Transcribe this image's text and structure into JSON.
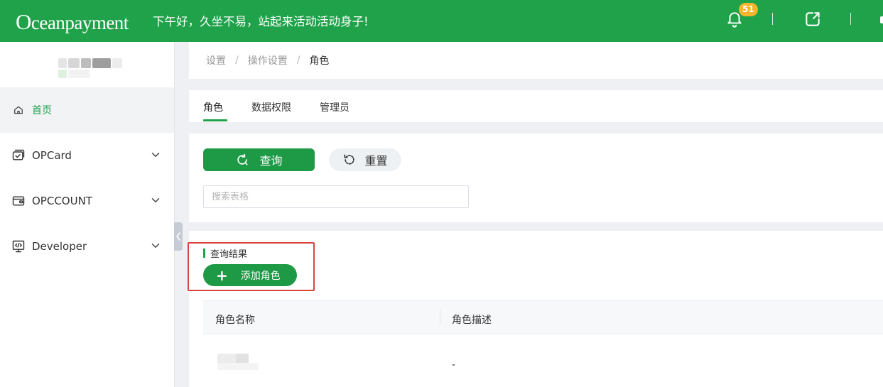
{
  "header": {
    "logo_initial": "O",
    "logo_rest": "ceanpayment",
    "greeting": "下午好，久坐不易，站起来活动活动身子!",
    "notification_count": "51",
    "colors": {
      "brand": "#1fa24a",
      "badge": "#f7b52c"
    },
    "icons": [
      "bell-icon",
      "external-link-icon"
    ]
  },
  "sidebar": {
    "items": [
      {
        "label": "首页",
        "icon": "home-icon",
        "active": true
      },
      {
        "label": "OPCard",
        "icon": "card-icon"
      },
      {
        "label": "OPCCOUNT",
        "icon": "wallet-icon"
      },
      {
        "label": "Developer",
        "icon": "code-monitor-icon"
      }
    ]
  },
  "breadcrumb": {
    "items": [
      "设置",
      "操作设置",
      "角色"
    ],
    "separator": "/"
  },
  "tabs": [
    {
      "label": "角色",
      "active": true
    },
    {
      "label": "数据权限"
    },
    {
      "label": "管理员"
    }
  ],
  "search": {
    "query_label": "查询",
    "reset_label": "重置",
    "placeholder": "搜索表格"
  },
  "results": {
    "title": "查询结果",
    "add_label": "添加角色",
    "columns": [
      "角色名称",
      "角色描述"
    ],
    "rows": [
      {
        "name": "",
        "description": "-"
      }
    ]
  }
}
